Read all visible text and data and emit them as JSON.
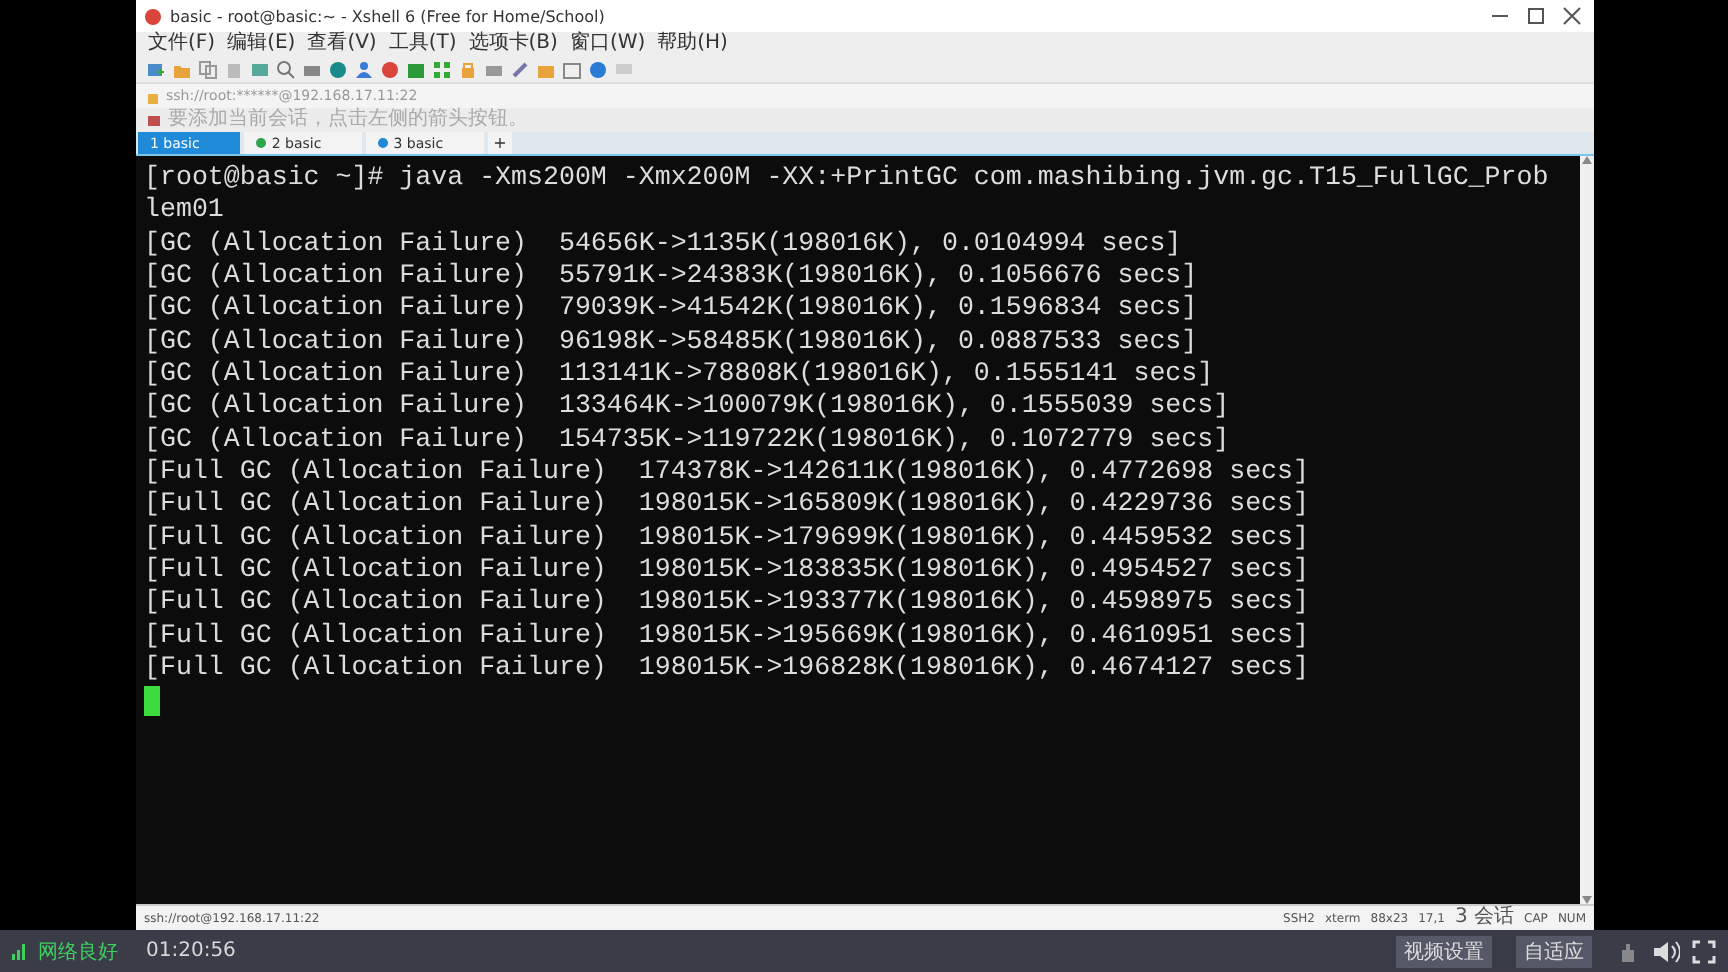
{
  "window": {
    "title": "basic - root@basic:~ - Xshell 6 (Free for Home/School)"
  },
  "menu": [
    "文件(F)",
    "编辑(E)",
    "查看(V)",
    "工具(T)",
    "选项卡(B)",
    "窗口(W)",
    "帮助(H)"
  ],
  "address": "ssh://root:******@192.168.17.11:22",
  "hint": "要添加当前会话，点击左侧的箭头按钮。",
  "tabs": [
    {
      "label": "1 basic",
      "selected": true
    },
    {
      "label": "2 basic",
      "selected": false
    },
    {
      "label": "3 basic",
      "selected": false
    }
  ],
  "new_tab": "+",
  "terminal": {
    "cursor": true,
    "lines": [
      "[root@basic ~]# java -Xms200M -Xmx200M -XX:+PrintGC com.mashibing.jvm.gc.T15_FullGC_Prob",
      "lem01",
      "[GC (Allocation Failure)  54656K->1135K(198016K), 0.0104994 secs]",
      "[GC (Allocation Failure)  55791K->24383K(198016K), 0.1056676 secs]",
      "[GC (Allocation Failure)  79039K->41542K(198016K), 0.1596834 secs]",
      "[GC (Allocation Failure)  96198K->58485K(198016K), 0.0887533 secs]",
      "[GC (Allocation Failure)  113141K->78808K(198016K), 0.1555141 secs]",
      "[GC (Allocation Failure)  133464K->100079K(198016K), 0.1555039 secs]",
      "[GC (Allocation Failure)  154735K->119722K(198016K), 0.1072779 secs]",
      "[Full GC (Allocation Failure)  174378K->142611K(198016K), 0.4772698 secs]",
      "[Full GC (Allocation Failure)  198015K->165809K(198016K), 0.4229736 secs]",
      "[Full GC (Allocation Failure)  198015K->179699K(198016K), 0.4459532 secs]",
      "[Full GC (Allocation Failure)  198015K->183835K(198016K), 0.4954527 secs]",
      "[Full GC (Allocation Failure)  198015K->193377K(198016K), 0.4598975 secs]",
      "[Full GC (Allocation Failure)  198015K->195669K(198016K), 0.4610951 secs]",
      "[Full GC (Allocation Failure)  198015K->196828K(198016K), 0.4674127 secs]"
    ]
  },
  "status_bar": {
    "address": "ssh://root@192.168.17.11:22",
    "items": [
      "SSH2",
      "xterm",
      "88x23",
      "17,1",
      "3 会话",
      "CAP",
      "NUM"
    ]
  },
  "player": {
    "network": "网络良好",
    "time": "01:20:56",
    "buttons": [
      "视频设置",
      "自适应"
    ]
  }
}
